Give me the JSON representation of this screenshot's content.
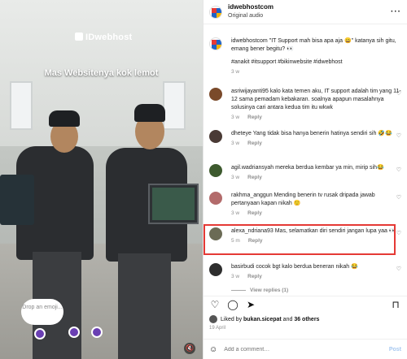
{
  "media": {
    "logo_text": "IDwebhost",
    "caption": "Mas Websitenya kok lemot",
    "drop_label": "Drop an emoji..."
  },
  "header": {
    "username": "idwebhostcom",
    "audio": "Original audio"
  },
  "caption_comment": {
    "username": "idwebhostcom",
    "text": "\"IT Support mah bisa apa aja 😀\" katanya sih gitu, emang bener begitu? 👀",
    "tags": "#anakit #itsupport #bikinwebsite #idwebhost",
    "time": "3 w"
  },
  "comments": [
    {
      "username": "asriwijayanti95",
      "text": "kalo kata temen aku, IT support adalah tim yang 11-12 sama pemadam kebakaran. soalnya apapun masalahnya solusinya cari antara kedua tim itu wkwk",
      "time": "3 w",
      "reply": "Reply",
      "avatar_color": "#7a4a2a"
    },
    {
      "username": "dheteye",
      "text": "Yang tidak bisa hanya benerin hatinya sendiri sih 🤣😂",
      "time": "3 w",
      "reply": "Reply",
      "avatar_color": "#4a3a35"
    },
    {
      "username": "agil.wadriansyah",
      "text": "mereka berdua kembar ya min, mirip sih😂",
      "time": "3 w",
      "reply": "Reply",
      "avatar_color": "#3d5a2e"
    },
    {
      "username": "rakhma_anggun",
      "text": "Mending benerin tv rusak dripada jawab pertanyaan kapan nikah 🙂",
      "time": "3 w",
      "reply": "Reply",
      "avatar_color": "#b36b6b"
    },
    {
      "username": "alexa_ndriana93",
      "text": "Mas, selamatkan diri sendiri jangan lupa yaa 👀",
      "time": "5 m",
      "reply": "Reply",
      "avatar_color": "#6b6b55"
    },
    {
      "username": "basirbudi",
      "text": "cocok bgt kalo berdua beneran nikah 😂",
      "time": "3 w",
      "reply": "Reply",
      "view_replies": "View replies (1)",
      "avatar_color": "#2e2e2e"
    }
  ],
  "likes": {
    "prefix": "Liked by",
    "user": "bukan.sicepat",
    "and": "and",
    "others": "36 others"
  },
  "date": "19 April",
  "add_comment": {
    "placeholder": "Add a comment…",
    "post_label": "Post"
  },
  "colors": {
    "highlight": "#e53935",
    "link": "#00376b"
  }
}
